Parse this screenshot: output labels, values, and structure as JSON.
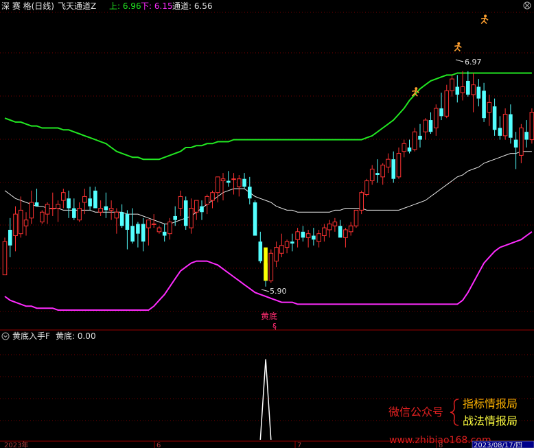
{
  "header": {
    "stock": "深 赛 格(日线)",
    "indicator": "飞天通道Z",
    "upper_label": "上: 6.96",
    "lower_label": "下: 6.15",
    "mid_label": "通道: 6.56"
  },
  "sub_header": {
    "indicator": "黄底入手F",
    "value_label": "黄底: 0.00"
  },
  "marks": {
    "high_label": "6.97",
    "low_label": "5.90",
    "signal_text": "黄底",
    "signal_glyph": "§"
  },
  "watermark": {
    "line1": "微信公众号",
    "line2a": "指标情报局",
    "line2b": "战法情报局",
    "url": "www.zhibiao168.com"
  },
  "axis": {
    "labels": [
      "2023年",
      "6",
      "7",
      "8",
      "2023/08/17/四"
    ]
  },
  "colors": {
    "up": "#ff3232",
    "down": "#54ffff",
    "upper": "#22e822",
    "mid": "#e8e8e8",
    "lower": "#ff2cff",
    "signal": "#ffff00",
    "grid": "#7a0000"
  },
  "chart_data": {
    "type": "candlestick",
    "price_range": [
      5.68,
      7.27
    ],
    "candles": [
      {
        "o": 5.93,
        "h": 6.12,
        "l": 5.93,
        "c": 6.1
      },
      {
        "o": 6.16,
        "h": 6.22,
        "l": 6.02,
        "c": 6.08
      },
      {
        "o": 6.13,
        "h": 6.28,
        "l": 6.05,
        "c": 6.24
      },
      {
        "o": 6.14,
        "h": 6.33,
        "l": 6.12,
        "c": 6.26
      },
      {
        "o": 6.18,
        "h": 6.25,
        "l": 6.13,
        "c": 6.21
      },
      {
        "o": 6.22,
        "h": 6.36,
        "l": 6.19,
        "c": 6.3
      },
      {
        "o": 6.3,
        "h": 6.37,
        "l": 6.28,
        "c": 6.28
      },
      {
        "o": 6.2,
        "h": 6.26,
        "l": 6.19,
        "c": 6.25
      },
      {
        "o": 6.24,
        "h": 6.3,
        "l": 6.19,
        "c": 6.29
      },
      {
        "o": 6.27,
        "h": 6.35,
        "l": 6.23,
        "c": 6.27
      },
      {
        "o": 6.27,
        "h": 6.31,
        "l": 6.2,
        "c": 6.29
      },
      {
        "o": 6.31,
        "h": 6.37,
        "l": 6.27,
        "c": 6.35
      },
      {
        "o": 6.32,
        "h": 6.36,
        "l": 6.22,
        "c": 6.27
      },
      {
        "o": 6.27,
        "h": 6.32,
        "l": 6.21,
        "c": 6.22
      },
      {
        "o": 6.21,
        "h": 6.3,
        "l": 6.2,
        "c": 6.27
      },
      {
        "o": 6.3,
        "h": 6.37,
        "l": 6.24,
        "c": 6.33
      },
      {
        "o": 6.32,
        "h": 6.38,
        "l": 6.26,
        "c": 6.28
      },
      {
        "o": 6.36,
        "h": 6.38,
        "l": 6.27,
        "c": 6.27
      },
      {
        "o": 6.25,
        "h": 6.31,
        "l": 6.23,
        "c": 6.27
      },
      {
        "o": 6.28,
        "h": 6.35,
        "l": 6.22,
        "c": 6.26
      },
      {
        "o": 6.26,
        "h": 6.31,
        "l": 6.21,
        "c": 6.27
      },
      {
        "o": 6.22,
        "h": 6.27,
        "l": 6.14,
        "c": 6.25
      },
      {
        "o": 6.25,
        "h": 6.29,
        "l": 6.17,
        "c": 6.18
      },
      {
        "o": 6.24,
        "h": 6.26,
        "l": 6.06,
        "c": 6.16
      },
      {
        "o": 6.18,
        "h": 6.27,
        "l": 6.09,
        "c": 6.1
      },
      {
        "o": 6.19,
        "h": 6.2,
        "l": 6.07,
        "c": 6.14
      },
      {
        "o": 6.19,
        "h": 6.22,
        "l": 6.05,
        "c": 6.1
      },
      {
        "o": 6.17,
        "h": 6.21,
        "l": 6.08,
        "c": 6.21
      },
      {
        "o": 6.19,
        "h": 6.24,
        "l": 6.17,
        "c": 6.19
      },
      {
        "o": 6.15,
        "h": 6.18,
        "l": 6.14,
        "c": 6.17
      },
      {
        "o": 6.15,
        "h": 6.19,
        "l": 6.1,
        "c": 6.13
      },
      {
        "o": 6.14,
        "h": 6.22,
        "l": 6.11,
        "c": 6.2
      },
      {
        "o": 6.23,
        "h": 6.28,
        "l": 6.18,
        "c": 6.21
      },
      {
        "o": 6.27,
        "h": 6.36,
        "l": 6.23,
        "c": 6.33
      },
      {
        "o": 6.31,
        "h": 6.33,
        "l": 6.16,
        "c": 6.18
      },
      {
        "o": 6.17,
        "h": 6.32,
        "l": 6.14,
        "c": 6.27
      },
      {
        "o": 6.25,
        "h": 6.31,
        "l": 6.21,
        "c": 6.31
      },
      {
        "o": 6.28,
        "h": 6.31,
        "l": 6.21,
        "c": 6.25
      },
      {
        "o": 6.29,
        "h": 6.34,
        "l": 6.24,
        "c": 6.33
      },
      {
        "o": 6.31,
        "h": 6.36,
        "l": 6.27,
        "c": 6.35
      },
      {
        "o": 6.35,
        "h": 6.43,
        "l": 6.3,
        "c": 6.43
      },
      {
        "o": 6.41,
        "h": 6.45,
        "l": 6.31,
        "c": 6.42
      },
      {
        "o": 6.41,
        "h": 6.46,
        "l": 6.38,
        "c": 6.4
      },
      {
        "o": 6.42,
        "h": 6.45,
        "l": 6.34,
        "c": 6.42
      },
      {
        "o": 6.38,
        "h": 6.44,
        "l": 6.33,
        "c": 6.42
      },
      {
        "o": 6.42,
        "h": 6.45,
        "l": 6.37,
        "c": 6.38
      },
      {
        "o": 6.38,
        "h": 6.43,
        "l": 6.29,
        "c": 6.32
      },
      {
        "o": 6.3,
        "h": 6.31,
        "l": 6.13,
        "c": 6.13
      },
      {
        "o": 6.1,
        "h": 6.15,
        "l": 5.99,
        "c": 6.0
      },
      {
        "o": 5.99,
        "h": 6.03,
        "l": 5.87,
        "c": 5.9
      },
      {
        "o": 5.9,
        "h": 6.06,
        "l": 5.89,
        "c": 6.04
      },
      {
        "o": 6.0,
        "h": 6.1,
        "l": 5.97,
        "c": 6.07
      },
      {
        "o": 6.04,
        "h": 6.14,
        "l": 6.02,
        "c": 6.08
      },
      {
        "o": 6.07,
        "h": 6.11,
        "l": 6.04,
        "c": 6.1
      },
      {
        "o": 6.1,
        "h": 6.14,
        "l": 6.05,
        "c": 6.09
      },
      {
        "o": 6.11,
        "h": 6.17,
        "l": 6.07,
        "c": 6.15
      },
      {
        "o": 6.15,
        "h": 6.18,
        "l": 6.1,
        "c": 6.12
      },
      {
        "o": 6.12,
        "h": 6.16,
        "l": 6.07,
        "c": 6.14
      },
      {
        "o": 6.13,
        "h": 6.17,
        "l": 6.08,
        "c": 6.11
      },
      {
        "o": 6.1,
        "h": 6.16,
        "l": 6.07,
        "c": 6.14
      },
      {
        "o": 6.13,
        "h": 6.19,
        "l": 6.1,
        "c": 6.17
      },
      {
        "o": 6.16,
        "h": 6.21,
        "l": 6.12,
        "c": 6.19
      },
      {
        "o": 6.18,
        "h": 6.22,
        "l": 6.15,
        "c": 6.2
      },
      {
        "o": 6.18,
        "h": 6.21,
        "l": 6.12,
        "c": 6.12
      },
      {
        "o": 6.12,
        "h": 6.17,
        "l": 6.07,
        "c": 6.16
      },
      {
        "o": 6.15,
        "h": 6.2,
        "l": 6.13,
        "c": 6.18
      },
      {
        "o": 6.18,
        "h": 6.26,
        "l": 6.17,
        "c": 6.26
      },
      {
        "o": 6.26,
        "h": 6.36,
        "l": 6.24,
        "c": 6.35
      },
      {
        "o": 6.34,
        "h": 6.42,
        "l": 6.33,
        "c": 6.41
      },
      {
        "o": 6.41,
        "h": 6.49,
        "l": 6.39,
        "c": 6.47
      },
      {
        "o": 6.45,
        "h": 6.52,
        "l": 6.4,
        "c": 6.44
      },
      {
        "o": 6.43,
        "h": 6.5,
        "l": 6.39,
        "c": 6.49
      },
      {
        "o": 6.48,
        "h": 6.55,
        "l": 6.45,
        "c": 6.52
      },
      {
        "o": 6.52,
        "h": 6.56,
        "l": 6.4,
        "c": 6.42
      },
      {
        "o": 6.43,
        "h": 6.58,
        "l": 6.42,
        "c": 6.55
      },
      {
        "o": 6.56,
        "h": 6.62,
        "l": 6.53,
        "c": 6.6
      },
      {
        "o": 6.58,
        "h": 6.62,
        "l": 6.55,
        "c": 6.56
      },
      {
        "o": 6.57,
        "h": 6.68,
        "l": 6.56,
        "c": 6.66
      },
      {
        "o": 6.64,
        "h": 6.7,
        "l": 6.58,
        "c": 6.62
      },
      {
        "o": 6.66,
        "h": 6.73,
        "l": 6.62,
        "c": 6.72
      },
      {
        "o": 6.72,
        "h": 6.76,
        "l": 6.65,
        "c": 6.66
      },
      {
        "o": 6.68,
        "h": 6.8,
        "l": 6.64,
        "c": 6.78
      },
      {
        "o": 6.78,
        "h": 6.86,
        "l": 6.72,
        "c": 6.74
      },
      {
        "o": 6.74,
        "h": 6.9,
        "l": 6.73,
        "c": 6.87
      },
      {
        "o": 6.87,
        "h": 6.95,
        "l": 6.84,
        "c": 6.93
      },
      {
        "o": 6.89,
        "h": 6.95,
        "l": 6.81,
        "c": 6.85
      },
      {
        "o": 6.86,
        "h": 6.97,
        "l": 6.82,
        "c": 6.89
      },
      {
        "o": 6.92,
        "h": 6.97,
        "l": 6.84,
        "c": 6.85
      },
      {
        "o": 6.85,
        "h": 6.96,
        "l": 6.76,
        "c": 6.9
      },
      {
        "o": 6.89,
        "h": 6.93,
        "l": 6.79,
        "c": 6.83
      },
      {
        "o": 6.87,
        "h": 6.91,
        "l": 6.71,
        "c": 6.73
      },
      {
        "o": 6.76,
        "h": 6.85,
        "l": 6.69,
        "c": 6.81
      },
      {
        "o": 6.79,
        "h": 6.83,
        "l": 6.64,
        "c": 6.67
      },
      {
        "o": 6.68,
        "h": 6.74,
        "l": 6.62,
        "c": 6.64
      },
      {
        "o": 6.64,
        "h": 6.78,
        "l": 6.62,
        "c": 6.75
      },
      {
        "o": 6.75,
        "h": 6.8,
        "l": 6.6,
        "c": 6.63
      },
      {
        "o": 6.62,
        "h": 6.66,
        "l": 6.47,
        "c": 6.58
      },
      {
        "o": 6.54,
        "h": 6.7,
        "l": 6.5,
        "c": 6.68
      },
      {
        "o": 6.66,
        "h": 6.72,
        "l": 6.58,
        "c": 6.62
      },
      {
        "o": 6.62,
        "h": 6.78,
        "l": 6.6,
        "c": 6.76
      }
    ],
    "upper_band": [
      6.73,
      6.72,
      6.71,
      6.71,
      6.7,
      6.69,
      6.69,
      6.68,
      6.68,
      6.68,
      6.68,
      6.67,
      6.67,
      6.66,
      6.65,
      6.64,
      6.63,
      6.62,
      6.61,
      6.6,
      6.58,
      6.56,
      6.55,
      6.54,
      6.53,
      6.53,
      6.52,
      6.52,
      6.52,
      6.52,
      6.53,
      6.54,
      6.55,
      6.56,
      6.58,
      6.58,
      6.59,
      6.59,
      6.6,
      6.6,
      6.61,
      6.61,
      6.61,
      6.62,
      6.62,
      6.62,
      6.62,
      6.62,
      6.62,
      6.62,
      6.62,
      6.62,
      6.62,
      6.62,
      6.62,
      6.62,
      6.62,
      6.62,
      6.62,
      6.62,
      6.62,
      6.62,
      6.62,
      6.62,
      6.62,
      6.62,
      6.62,
      6.62,
      6.63,
      6.64,
      6.66,
      6.68,
      6.7,
      6.72,
      6.75,
      6.78,
      6.82,
      6.85,
      6.88,
      6.9,
      6.92,
      6.93,
      6.94,
      6.95,
      6.95,
      6.96,
      6.96,
      6.96,
      6.96,
      6.96,
      6.96,
      6.96,
      6.96,
      6.96,
      6.96,
      6.96,
      6.96,
      6.96,
      6.96,
      6.96
    ],
    "mid_band": [
      6.36,
      6.34,
      6.32,
      6.31,
      6.3,
      6.29,
      6.28,
      6.28,
      6.27,
      6.27,
      6.27,
      6.26,
      6.26,
      6.26,
      6.26,
      6.26,
      6.26,
      6.25,
      6.25,
      6.25,
      6.25,
      6.25,
      6.25,
      6.24,
      6.24,
      6.24,
      6.23,
      6.22,
      6.21,
      6.2,
      6.19,
      6.19,
      6.2,
      6.21,
      6.22,
      6.23,
      6.25,
      6.27,
      6.29,
      6.31,
      6.33,
      6.35,
      6.36,
      6.37,
      6.37,
      6.37,
      6.35,
      6.33,
      6.32,
      6.31,
      6.3,
      6.28,
      6.27,
      6.26,
      6.26,
      6.25,
      6.25,
      6.25,
      6.25,
      6.25,
      6.25,
      6.25,
      6.26,
      6.26,
      6.27,
      6.27,
      6.27,
      6.27,
      6.26,
      6.26,
      6.26,
      6.26,
      6.26,
      6.26,
      6.26,
      6.27,
      6.28,
      6.29,
      6.3,
      6.31,
      6.33,
      6.35,
      6.37,
      6.39,
      6.41,
      6.43,
      6.44,
      6.46,
      6.47,
      6.48,
      6.5,
      6.51,
      6.52,
      6.53,
      6.54,
      6.55,
      6.55,
      6.56,
      6.56,
      6.56
    ],
    "lower_band": [
      5.82,
      5.8,
      5.79,
      5.78,
      5.77,
      5.77,
      5.76,
      5.76,
      5.76,
      5.76,
      5.75,
      5.75,
      5.75,
      5.75,
      5.75,
      5.75,
      5.75,
      5.75,
      5.75,
      5.75,
      5.75,
      5.75,
      5.75,
      5.75,
      5.75,
      5.75,
      5.75,
      5.75,
      5.77,
      5.8,
      5.83,
      5.87,
      5.91,
      5.95,
      5.97,
      5.99,
      6.0,
      6.0,
      6.0,
      5.99,
      5.98,
      5.96,
      5.94,
      5.92,
      5.9,
      5.88,
      5.86,
      5.84,
      5.83,
      5.82,
      5.81,
      5.8,
      5.79,
      5.79,
      5.79,
      5.78,
      5.78,
      5.78,
      5.78,
      5.78,
      5.78,
      5.78,
      5.78,
      5.78,
      5.78,
      5.78,
      5.78,
      5.78,
      5.78,
      5.78,
      5.78,
      5.78,
      5.78,
      5.78,
      5.78,
      5.78,
      5.78,
      5.78,
      5.78,
      5.78,
      5.78,
      5.78,
      5.78,
      5.78,
      5.78,
      5.78,
      5.8,
      5.84,
      5.89,
      5.94,
      5.99,
      6.02,
      6.05,
      6.07,
      6.08,
      6.09,
      6.1,
      6.11,
      6.13,
      6.15
    ],
    "signal_index": 49,
    "sub_values": [
      0,
      0,
      0,
      0,
      0,
      0,
      0,
      0,
      0,
      0,
      0,
      0,
      0,
      0,
      0,
      0,
      0,
      0,
      0,
      0,
      0,
      0,
      0,
      0,
      0,
      0,
      0,
      0,
      0,
      0,
      0,
      0,
      0,
      0,
      0,
      0,
      0,
      0,
      0,
      0,
      0,
      0,
      0,
      0,
      0,
      0,
      0,
      0,
      0,
      1,
      0,
      0,
      0,
      0,
      0,
      0,
      0,
      0,
      0,
      0,
      0,
      0,
      0,
      0,
      0,
      0,
      0,
      0,
      0,
      0,
      0,
      0,
      0,
      0,
      0,
      0,
      0,
      0,
      0,
      0,
      0,
      0,
      0,
      0,
      0,
      0,
      0,
      0,
      0,
      0,
      0,
      0,
      0,
      0,
      0,
      0,
      0,
      0,
      0,
      0
    ],
    "sub_range": [
      0,
      1.2
    ]
  }
}
